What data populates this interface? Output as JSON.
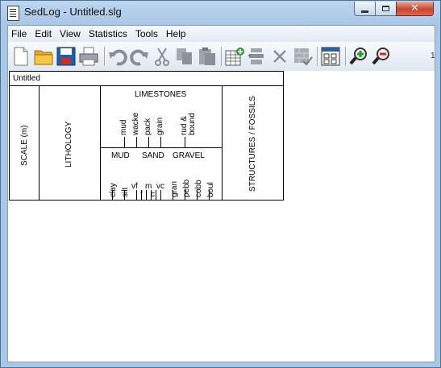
{
  "window": {
    "title": "SedLog - Untitled.slg"
  },
  "menu": [
    "File",
    "Edit",
    "View",
    "Statistics",
    "Tools",
    "Help"
  ],
  "toolbar": {
    "buttons": [
      "new-file-icon",
      "open-folder-icon",
      "save-icon",
      "print-icon",
      "undo-icon",
      "redo-icon",
      "cut-icon",
      "copy-icon",
      "paste-icon",
      "insert-bed-icon",
      "insert-bed-below-icon",
      "delete-icon",
      "erase-icon",
      "columns-icon",
      "zoom-in-icon",
      "zoom-out-icon"
    ],
    "overflow_label": "1"
  },
  "log": {
    "title": "Untitled",
    "scale_label": "SCALE (m)",
    "lithology_label": "LITHOLOGY",
    "limestones_label": "LIMESTONES",
    "limestone_classes": [
      "mud",
      "wacke",
      "pack",
      "grain",
      "rud &",
      "bound"
    ],
    "grain_groups": [
      "MUD",
      "SAND",
      "GRAVEL"
    ],
    "grain_sizes": [
      "clay",
      "silt",
      "vf",
      "f",
      "m",
      "c",
      "vc",
      "gran",
      "pebb",
      "cobb",
      "boul"
    ],
    "structures_label": "STRUCTURES / FOSSILS"
  }
}
